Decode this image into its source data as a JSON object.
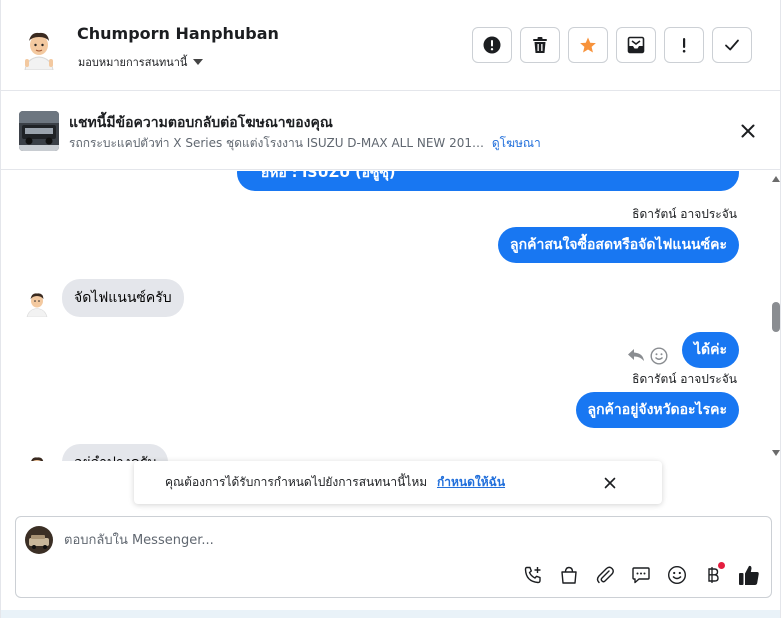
{
  "header": {
    "contact_name": "Chumporn Hanphuban",
    "assign_label": "มอบหมายการสนทนานี้"
  },
  "ad": {
    "title": "แชทนี้มีข้อความตอบกลับต่อโฆษณาของคุณ",
    "subtitle": "รถกระบะแคปตัวท่า X Series ชุดแต่งโรงงาน ISUZU D-MAX ALL NEW 201…",
    "link": "ดูโฆษณา"
  },
  "messages": {
    "m0": "ยี่ห้อ : ISUZU (อีซูซุ)",
    "sender1": "ธิดารัตน์ อาจประจัน",
    "m1": "ลูกค้าสนใจซื้อสดหรือจัดไฟแนนซ์คะ",
    "m2": "จัดไฟแนนซ์ครับ",
    "m3": "ได้ค่ะ",
    "sender2": "ธิดารัตน์ อาจประจัน",
    "m4": "ลูกค้าอยู่จังหวัดอะไรคะ",
    "m5": "อยู่ลำปางครับ"
  },
  "notification": {
    "text": "คุณต้องการได้รับการกำหนดไปยังการสนทนานี้ไหม",
    "link": "กำหนดให้ฉัน"
  },
  "composer": {
    "placeholder": "ตอบกลับใน Messenger..."
  },
  "colors": {
    "accent": "#1877f2",
    "star": "#f7923b",
    "link": "#216fdb"
  }
}
